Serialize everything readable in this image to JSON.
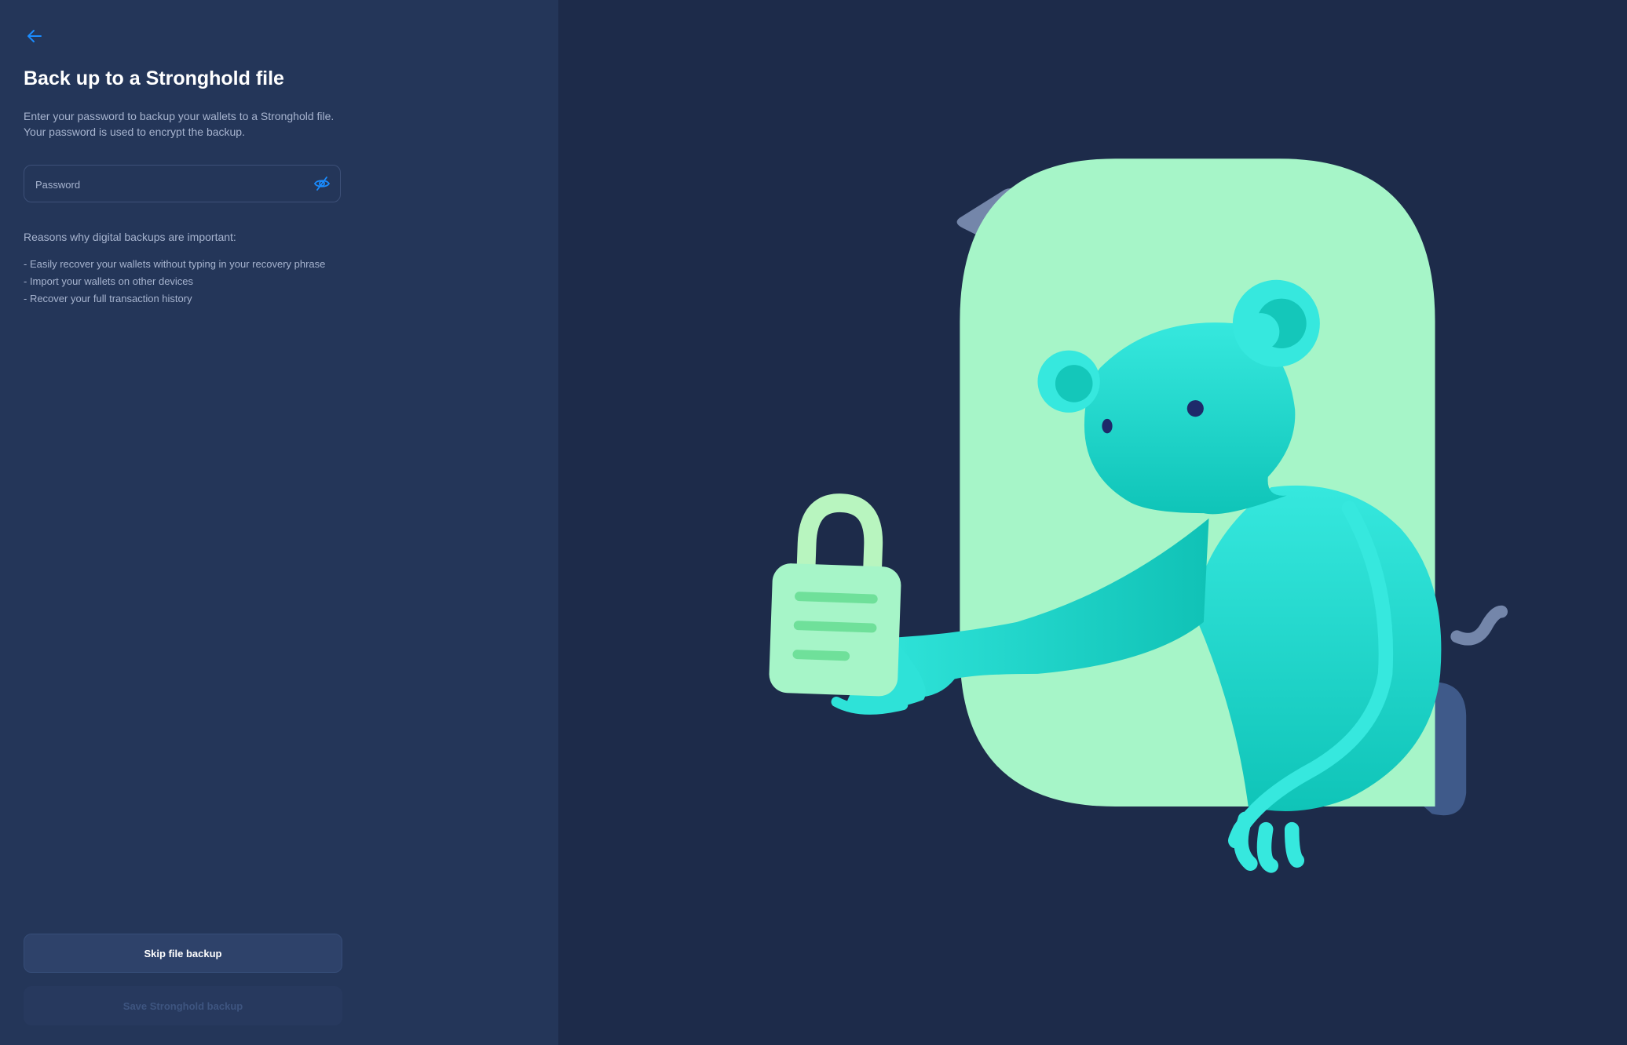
{
  "title": "Back up to a Stronghold file",
  "description": [
    "Enter your password to backup your wallets to a Stronghold file.",
    "Your password is used to encrypt the backup."
  ],
  "password": {
    "placeholder": "Password",
    "value": ""
  },
  "reasons_heading": "Reasons why digital backups are important:",
  "reasons": [
    "- Easily recover your wallets without typing in your recovery phrase",
    "- Import your wallets on other devices",
    "- Recover your full transaction history"
  ],
  "buttons": {
    "skip": "Skip file backup",
    "save": "Save Stronghold backup"
  },
  "icons": {
    "back": "arrow-left-icon",
    "toggle": "eye-slash-icon"
  },
  "colors": {
    "accent": "#1a8cff",
    "left_bg": "#243659",
    "right_bg": "#1d2b4a"
  }
}
